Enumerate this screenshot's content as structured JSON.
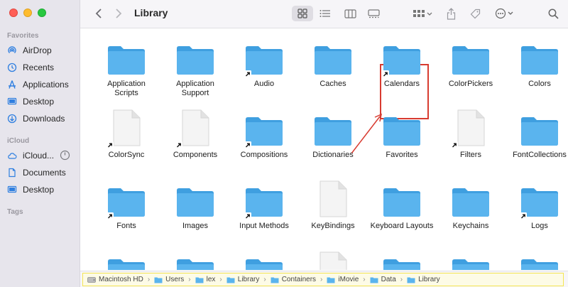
{
  "window": {
    "title": "Library"
  },
  "sidebar": {
    "favorites_title": "Favorites",
    "favorites": [
      {
        "label": "AirDrop",
        "icon": "airdrop-icon"
      },
      {
        "label": "Recents",
        "icon": "clock-icon"
      },
      {
        "label": "Applications",
        "icon": "applications-icon"
      },
      {
        "label": "Desktop",
        "icon": "desktop-icon"
      },
      {
        "label": "Downloads",
        "icon": "downloads-icon"
      }
    ],
    "icloud_title": "iCloud",
    "icloud": [
      {
        "label": "iCloud...",
        "icon": "cloud-icon"
      },
      {
        "label": "Documents",
        "icon": "document-icon"
      },
      {
        "label": "Desktop",
        "icon": "desktop-icon"
      }
    ],
    "tags_title": "Tags",
    "accent": "#2f7fe0"
  },
  "items": [
    {
      "label": "Application\nScripts",
      "kind": "folder",
      "alias": false
    },
    {
      "label": "Application\nSupport",
      "kind": "folder",
      "alias": false
    },
    {
      "label": "Audio",
      "kind": "folder",
      "alias": true
    },
    {
      "label": "Caches",
      "kind": "folder",
      "alias": false
    },
    {
      "label": "Calendars",
      "kind": "folder",
      "alias": true
    },
    {
      "label": "ColorPickers",
      "kind": "folder",
      "alias": false
    },
    {
      "label": "Colors",
      "kind": "folder",
      "alias": false
    },
    {
      "label": "ColorSync",
      "kind": "file",
      "alias": true
    },
    {
      "label": "Components",
      "kind": "file",
      "alias": true
    },
    {
      "label": "Compositions",
      "kind": "folder",
      "alias": true
    },
    {
      "label": "Dictionaries",
      "kind": "folder",
      "alias": false
    },
    {
      "label": "Favorites",
      "kind": "folder",
      "alias": false
    },
    {
      "label": "Filters",
      "kind": "file",
      "alias": true
    },
    {
      "label": "FontCollections",
      "kind": "folder",
      "alias": false
    },
    {
      "label": "Fonts",
      "kind": "folder",
      "alias": true
    },
    {
      "label": "Images",
      "kind": "folder",
      "alias": false
    },
    {
      "label": "Input Methods",
      "kind": "folder",
      "alias": true
    },
    {
      "label": "KeyBindings",
      "kind": "file",
      "alias": false
    },
    {
      "label": "Keyboard Layouts",
      "kind": "folder",
      "alias": false
    },
    {
      "label": "Keychains",
      "kind": "folder",
      "alias": false
    },
    {
      "label": "Logs",
      "kind": "folder",
      "alias": true
    },
    {
      "label": "",
      "kind": "folder",
      "alias": false
    },
    {
      "label": "",
      "kind": "folder",
      "alias": false
    },
    {
      "label": "",
      "kind": "folder",
      "alias": false
    },
    {
      "label": "",
      "kind": "file",
      "alias": false
    },
    {
      "label": "",
      "kind": "folder",
      "alias": false
    },
    {
      "label": "",
      "kind": "folder",
      "alias": false
    },
    {
      "label": "",
      "kind": "folder",
      "alias": false
    }
  ],
  "path": [
    "Macintosh HD",
    "Users",
    "lex",
    "Library",
    "Containers",
    "iMovie",
    "Data",
    "Library"
  ],
  "colors": {
    "folder": "#5ab4ee",
    "folder_top": "#3f9fe0",
    "highlight": "#d83b30",
    "pathbar_border": "#f4e552"
  }
}
